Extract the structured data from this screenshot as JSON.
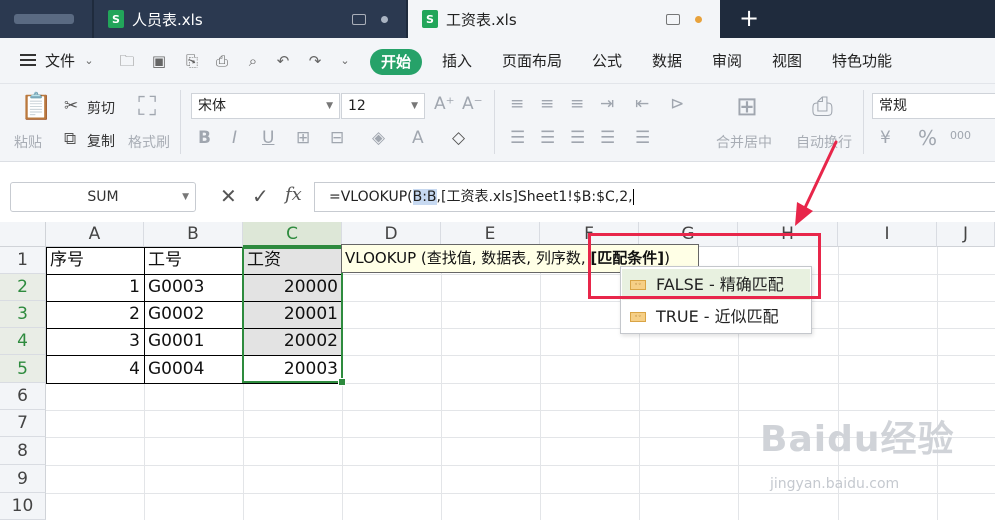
{
  "tabs": [
    {
      "label": "人员表.xls"
    },
    {
      "label": "工资表.xls"
    }
  ],
  "tab_icon_letter": "S",
  "new_tab_glyph": "+",
  "menu": {
    "file": "文件",
    "start": "开始",
    "items": [
      "插入",
      "页面布局",
      "公式",
      "数据",
      "审阅",
      "视图",
      "特色功能"
    ]
  },
  "ribbon": {
    "paste": "粘贴",
    "cut": "剪切",
    "copy": "复制",
    "format_painter": "格式刷",
    "font_name": "宋体",
    "font_size": "12",
    "merge_center": "合并居中",
    "auto_wrap": "自动换行",
    "number_format": "常规",
    "percent": "%",
    "thousands": "000"
  },
  "formula_bar": {
    "name_box": "SUM",
    "fx": "fx",
    "formula_prefix": "=VLOOKUP(",
    "formula_highlight": "B:B",
    "formula_suffix": ",[工资表.xls]Sheet1!$B:$C,2,"
  },
  "columns": [
    "A",
    "B",
    "C",
    "D",
    "E",
    "F",
    "G",
    "H",
    "I",
    "J"
  ],
  "rows": [
    "1",
    "2",
    "3",
    "4",
    "5",
    "6",
    "7",
    "8",
    "9",
    "10"
  ],
  "table": {
    "headers": [
      "序号",
      "工号",
      "工资"
    ],
    "rows": [
      [
        "1",
        "G0003",
        "20000"
      ],
      [
        "2",
        "G0002",
        "20001"
      ],
      [
        "3",
        "G0001",
        "20002"
      ],
      [
        "4",
        "G0004",
        "20003"
      ]
    ]
  },
  "tooltip": {
    "prefix": "VLOOKUP (查找值, 数据表, 列序数, ",
    "bold": "[匹配条件]",
    "suffix": ")"
  },
  "autocomplete": [
    {
      "label": "FALSE - 精确匹配",
      "active": true
    },
    {
      "label": "TRUE - 近似匹配",
      "active": false
    }
  ],
  "watermark": {
    "logo": "Baidu经验",
    "url": "jingyan.baidu.com"
  },
  "colors": {
    "accent_green": "#26a269",
    "selection_green": "#2e8b3e",
    "annotation_red": "#e8264a",
    "tab_bar": "#1f2b3d"
  }
}
